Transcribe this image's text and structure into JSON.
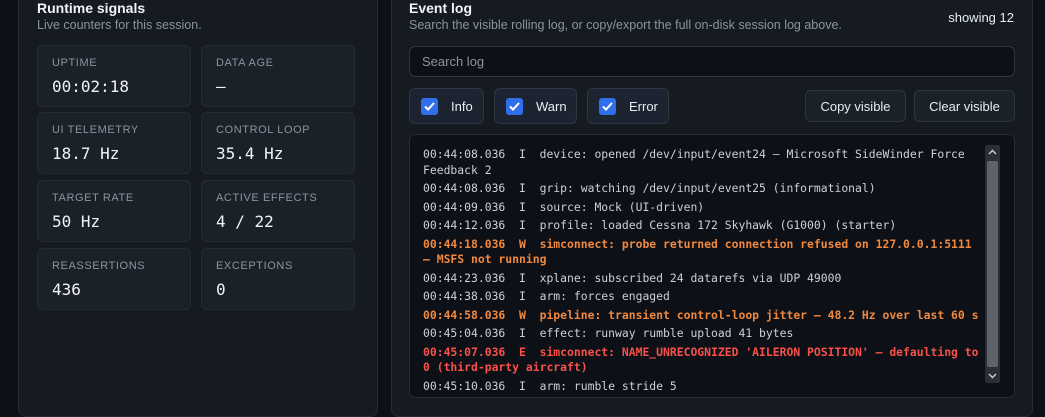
{
  "runtime": {
    "title": "Runtime signals",
    "subtitle": "Live counters for this session.",
    "stats": [
      {
        "label": "UPTIME",
        "value": "00:02:18"
      },
      {
        "label": "DATA AGE",
        "value": "—"
      },
      {
        "label": "UI TELEMETRY",
        "value": "18.7 Hz"
      },
      {
        "label": "CONTROL LOOP",
        "value": "35.4 Hz"
      },
      {
        "label": "TARGET RATE",
        "value": "50 Hz"
      },
      {
        "label": "ACTIVE EFFECTS",
        "value": "4 / 22"
      },
      {
        "label": "REASSERTIONS",
        "value": "436"
      },
      {
        "label": "EXCEPTIONS",
        "value": "0"
      }
    ]
  },
  "event_log": {
    "title": "Event log",
    "subtitle": "Search the visible rolling log, or copy/export the full on-disk session log above.",
    "showing": "showing 12",
    "search_placeholder": "Search log",
    "filters": [
      {
        "label": "Info",
        "checked": true
      },
      {
        "label": "Warn",
        "checked": true
      },
      {
        "label": "Error",
        "checked": true
      }
    ],
    "copy_label": "Copy visible",
    "clear_label": "Clear visible",
    "lines": [
      {
        "level": "I",
        "text": "00:44:08.036  I  device: opened /dev/input/event24 — Microsoft SideWinder Force Feedback 2"
      },
      {
        "level": "I",
        "text": "00:44:08.036  I  grip: watching /dev/input/event25 (informational)"
      },
      {
        "level": "I",
        "text": "00:44:09.036  I  source: Mock (UI-driven)"
      },
      {
        "level": "I",
        "text": "00:44:12.036  I  profile: loaded Cessna 172 Skyhawk (G1000) (starter)"
      },
      {
        "level": "W",
        "text": "00:44:18.036  W  simconnect: probe returned connection refused on 127.0.0.1:5111 — MSFS not running"
      },
      {
        "level": "I",
        "text": "00:44:23.036  I  xplane: subscribed 24 datarefs via UDP 49000"
      },
      {
        "level": "I",
        "text": "00:44:38.036  I  arm: forces engaged"
      },
      {
        "level": "W",
        "text": "00:44:58.036  W  pipeline: transient control-loop jitter — 48.2 Hz over last 60 s"
      },
      {
        "level": "I",
        "text": "00:45:04.036  I  effect: runway rumble upload 41 bytes"
      },
      {
        "level": "E",
        "text": "00:45:07.036  E  simconnect: NAME_UNRECOGNIZED 'AILERON POSITION' — defaulting to 0 (third-party aircraft)"
      },
      {
        "level": "I",
        "text": "00:45:10.036  I  arm: rumble stride 5"
      }
    ]
  }
}
